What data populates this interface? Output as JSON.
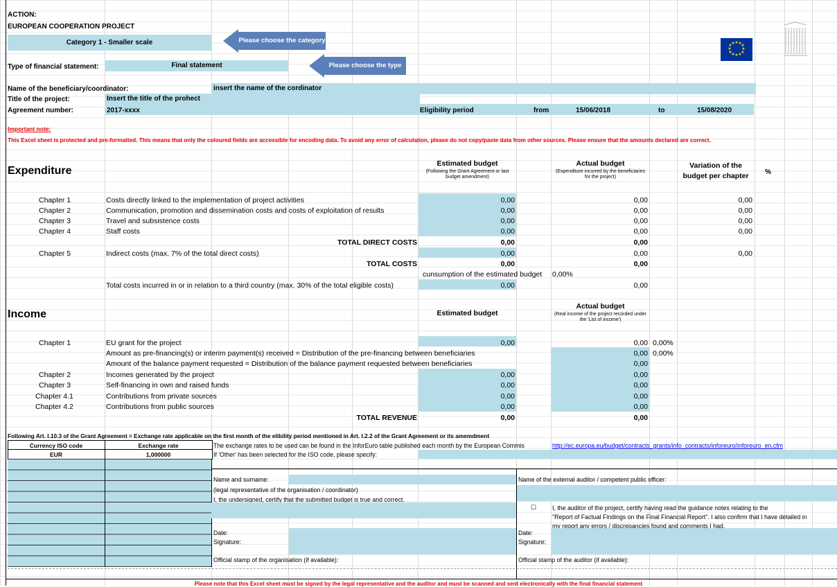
{
  "header": {
    "action_label": "ACTION:",
    "project_label": "EUROPEAN COOPERATION PROJECT",
    "category_value": "Category 1 - Smaller scale",
    "category_arrow": "Please choose the category",
    "type_label": "Type of financial statement:",
    "type_value": "Final statement",
    "type_arrow": "Please choose the type"
  },
  "project": {
    "beneficiary_label": "Name of the beneficiary/coordinator:",
    "beneficiary_value": "insert the name of the cordinator",
    "title_label": "Title of the project:",
    "title_value": "Insert the title of the prohect",
    "agreement_label": "Agreement number:",
    "agreement_value": "2017-xxxx",
    "eligibility_label": "Eligibility period",
    "from_label": "from",
    "from_value": "15/06/2018",
    "to_label": "to",
    "to_value": "15/08/2020"
  },
  "notes": {
    "important_label": "Important note:",
    "important_text": "This Excel sheet is protected and pre-formatted. This means that only the coloured fields are accessible for encoding data.  To avoid any error of calculation, please do not copy/paste data from other sources. Please ensure that the amounts declared are correct."
  },
  "expenditure": {
    "title": "Expenditure",
    "est_header": "Estimated budget",
    "est_sub": "(Following the Grant Agreement or last budget amendment)",
    "act_header": "Actual budget",
    "act_sub": "(Expenditure incurred by the beneficiaries for the project)",
    "var_header": "Variation of the budget per chapter",
    "pct_header": "%",
    "rows": [
      {
        "chapter": "Chapter 1",
        "desc": "Costs directly linked to the implementation of project activities",
        "est": "0,00",
        "act": "0,00",
        "var": "0,00"
      },
      {
        "chapter": "Chapter 2",
        "desc": "Communication, promotion and dissemination costs and costs of exploitation of results",
        "est": "0,00",
        "act": "0,00",
        "var": "0,00"
      },
      {
        "chapter": "Chapter 3",
        "desc": "Travel and subsistence costs",
        "est": "0,00",
        "act": "0,00",
        "var": "0,00"
      },
      {
        "chapter": "Chapter 4",
        "desc": "Staff costs",
        "est": "0,00",
        "act": "0,00",
        "var": "0,00"
      }
    ],
    "total_direct_label": "TOTAL DIRECT COSTS",
    "total_direct_est": "0,00",
    "total_direct_act": "0,00",
    "ch5": {
      "chapter": "Chapter 5",
      "desc": "Indirect costs (max. 7% of the total direct costs)",
      "est": "0,00",
      "act": "0,00",
      "var": "0,00"
    },
    "total_costs_label": "TOTAL COSTS",
    "total_costs_est": "0,00",
    "total_costs_act": "0,00",
    "consumption_label": "cunsumption of the estimated budget",
    "consumption_value": "0,00%",
    "third_country_label": "Total costs incurred in or in relation to a third country (max. 30% of the total eligible costs)",
    "third_country_est": "0,00",
    "third_country_act": "0,00"
  },
  "income": {
    "title": "Income",
    "est_header": "Estimated budget",
    "act_header": "Actual budget",
    "act_sub": "(Real income of the project recorded under the 'List of income')",
    "ch1": {
      "chapter": "Chapter 1",
      "desc": "EU grant for the project",
      "est": "0,00",
      "act": "0,00",
      "pct": "0,00%"
    },
    "prefin_label": "Amount as pre-financing(s)  or interim payment(s)  received = Distribution of the pre-financing between beneficiaries",
    "prefin_act": "0,00",
    "prefin_pct": "0,00%",
    "balance_label": "Amount of the balance payment requested = Distribution of the balance payment requested between beneficiaries",
    "balance_act": "0,00",
    "rows": [
      {
        "chapter": "Chapter 2",
        "desc": "Incomes generated by the project",
        "est": "0,00",
        "act": "0,00"
      },
      {
        "chapter": "Chapter 3",
        "desc": "Self-financing in own and raised funds",
        "est": "0,00",
        "act": "0,00"
      },
      {
        "chapter": "Chapter 4.1",
        "desc": "Contributions from private sources",
        "est": "0,00",
        "act": "0,00"
      },
      {
        "chapter": "Chapter 4.2",
        "desc": "Contributions from public sources",
        "est": "0,00",
        "act": "0,00"
      }
    ],
    "total_label": "TOTAL REVENUE",
    "total_est": "0,00",
    "total_act": "0,00"
  },
  "exchange": {
    "note": "Following Art. I.10.3 of the Grant Agreement = Exchange rate applicable on the first month of the elibility period mentioned in Art. I.2.2 of the Grant Agreement or its amemdment",
    "currency_header": "Currency ISO code",
    "rate_header": "Exchange rate",
    "currency_value": "EUR",
    "rate_value": "1,000000",
    "inforeuro_text": "The exchange rates to be used can be found in the InforEuro table published each month by the European Commis",
    "inforeuro_link": "http://ec.europa.eu/budget/contracts_grants/info_contracts/inforeuro/inforeuro_en.cfm",
    "other_label": "If 'Other' has been selected for the ISO code, please specify:"
  },
  "signature": {
    "name_label": "Name and surname:",
    "legal_rep": "(legal representative of the organisation / coordinator)",
    "certify": "I, the undersigned, certify that the submitted budget is true and correct.",
    "date_label": "Date:",
    "signature_label": "Signature:",
    "stamp_label": "Official stamp of the organisation (if available):",
    "auditor_name_label": "Name of the external auditor / competent public officer:",
    "auditor_checkbox": "☐",
    "auditor_cert_1": "I, the auditor of the project, certify having read the guidance notes relating to the",
    "auditor_cert_2": "\"Report of Factual Findings on the Final Financial Report\". I also confirm that I have detailed in",
    "auditor_cert_3": "my report any errors / discrepancies found and comments I had.",
    "auditor_date_label": "Date:",
    "auditor_signature_label": "Signature:",
    "auditor_stamp_label": "Official stamp of the auditor (if available):",
    "footer_note": "Please note that this Excel sheet must be signed by the legal representative and the auditor and must be scanned and sent electronically with the final financial statement"
  },
  "colors": {
    "input_fill": "#b7dee8",
    "arrow_fill": "#5b80b9",
    "eu_blue": "#003399",
    "eu_star": "#ffcc00",
    "warning_red": "#e00000"
  },
  "icons": {
    "eu_flag": "eu-flag-icon",
    "commission_logo": "european-commission-logo"
  }
}
